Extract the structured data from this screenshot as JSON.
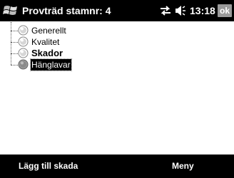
{
  "titlebar": {
    "title": "Provträd stamnr: 4",
    "clock": "13:18",
    "ok_label": "ok",
    "start_icon": "windows-start-icon",
    "connectivity_icon": "sync-arrows-icon",
    "volume_icon": "speaker-icon"
  },
  "tree": {
    "items": [
      {
        "label": "Generellt",
        "bold": false,
        "selected": false,
        "icon": "node-icon"
      },
      {
        "label": "Kvalitet",
        "bold": false,
        "selected": false,
        "icon": "node-icon"
      },
      {
        "label": "Skador",
        "bold": true,
        "selected": false,
        "icon": "node-icon"
      },
      {
        "label": "Hänglavar",
        "bold": false,
        "selected": true,
        "icon": "node-icon"
      }
    ]
  },
  "softkeys": {
    "left": "Lägg till skada",
    "right": "Meny"
  },
  "colors": {
    "bar_background": "#000000",
    "ok_button": "#9a9a9a",
    "content_background": "#ffffff"
  }
}
